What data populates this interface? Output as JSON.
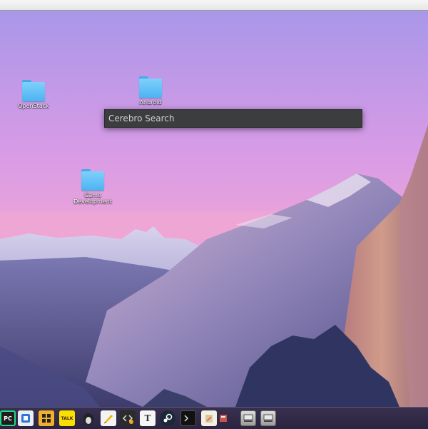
{
  "desktop": {
    "icons": [
      {
        "label": "OpenStack"
      },
      {
        "label": "Android"
      },
      {
        "label": "Game Development"
      }
    ]
  },
  "search": {
    "placeholder": "Cerebro Search",
    "value": ""
  },
  "dock": {
    "items": [
      {
        "icon": "pycharm-icon",
        "glyph": "PC"
      },
      {
        "icon": "notes-icon",
        "glyph": ""
      },
      {
        "icon": "puzzle-icon",
        "glyph": ""
      },
      {
        "icon": "kakaotalk-icon",
        "glyph": "TALK"
      },
      {
        "icon": "penguin-icon",
        "glyph": ""
      },
      {
        "icon": "text-editor-icon",
        "glyph": ""
      },
      {
        "icon": "code-editor-icon",
        "glyph": ""
      },
      {
        "icon": "typora-icon",
        "glyph": "T"
      },
      {
        "icon": "steam-icon",
        "glyph": ""
      },
      {
        "icon": "terminal-icon",
        "glyph": ""
      },
      {
        "icon": "archive-icon",
        "glyph": ""
      },
      {
        "icon": "files-icon",
        "glyph": ""
      },
      {
        "icon": "drive-icon",
        "glyph": ""
      },
      {
        "icon": "drive-icon",
        "glyph": ""
      }
    ]
  },
  "colors": {
    "sky_top": "#b9a0e6",
    "sky_mid": "#d99ee4",
    "horizon": "#f3a7d2",
    "rock": "#c98a7c",
    "dock": "#2f2945"
  }
}
